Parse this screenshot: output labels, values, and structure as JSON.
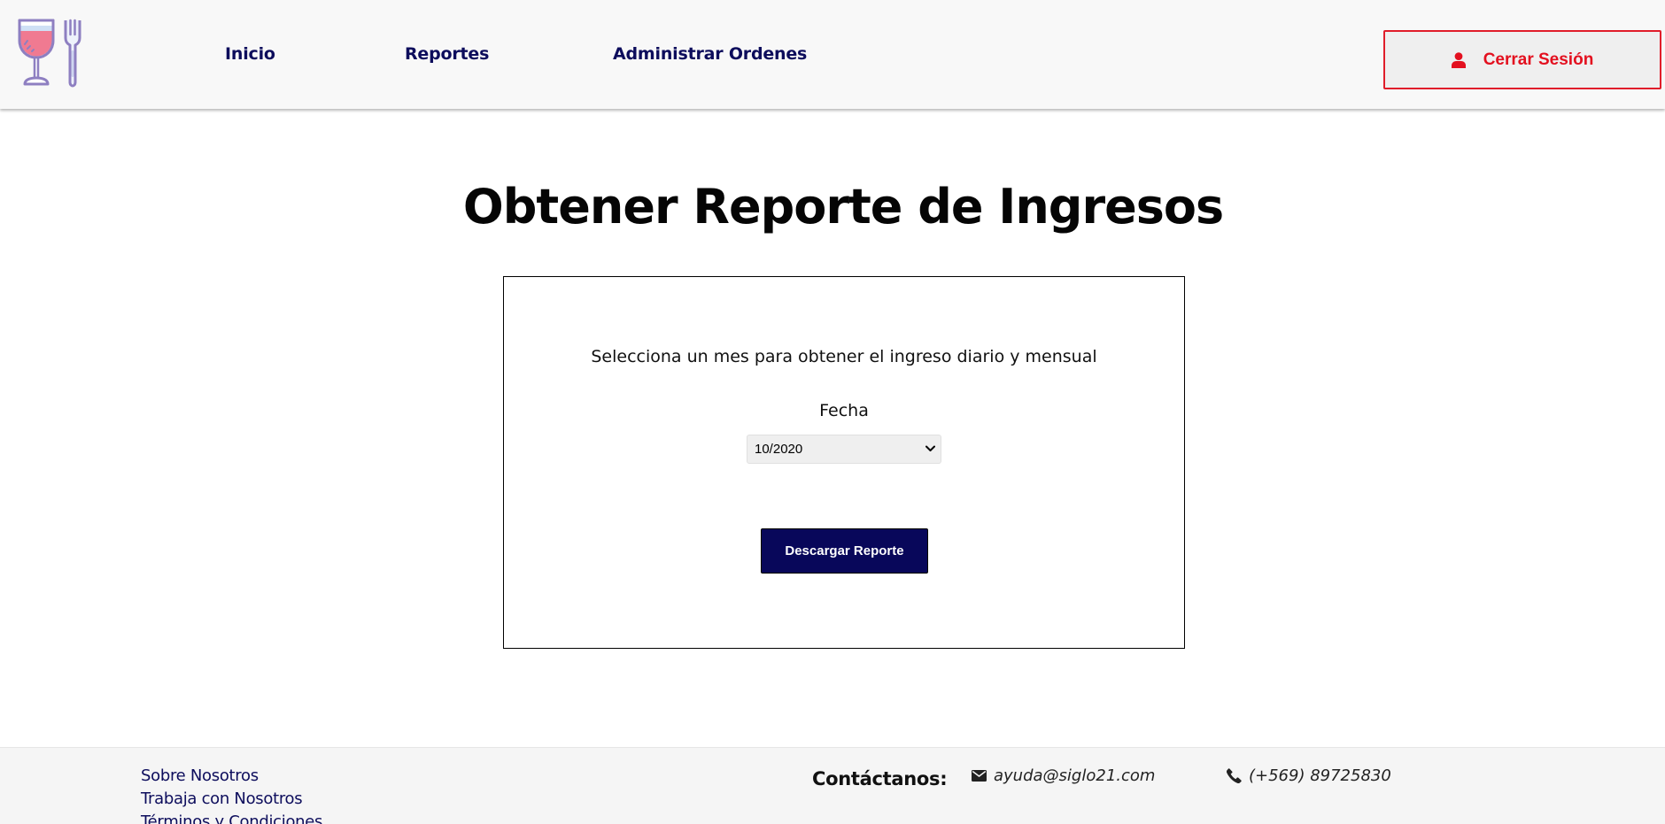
{
  "nav": {
    "items": [
      {
        "label": "Inicio"
      },
      {
        "label": "Reportes"
      },
      {
        "label": "Administrar Ordenes"
      }
    ],
    "logout_label": "Cerrar Sesión"
  },
  "main": {
    "title": "Obtener Reporte de Ingresos",
    "instruction": "Selecciona un mes para obtener el ingreso diario y mensual",
    "date_label": "Fecha",
    "date_selected": "10/2020",
    "download_label": "Descargar Reporte"
  },
  "footer": {
    "links": [
      {
        "label": "Sobre Nosotros"
      },
      {
        "label": "Trabaja con Nosotros"
      },
      {
        "label": "Términos y Condiciones"
      }
    ],
    "contact_heading": "Contáctanos:",
    "email": "ayuda@siglo21.com",
    "phone": "(+569) 89725830"
  },
  "icons": {
    "logo": "wine-glass-fork-logo",
    "logout": "user-icon",
    "select": "chevron-down-icon",
    "email": "envelope-icon",
    "phone": "phone-icon"
  },
  "colors": {
    "nav_text": "#0d0d5c",
    "logout_accent": "#e3101f",
    "button_bg": "#08075a",
    "header_bg": "#f8f8f8",
    "footer_bg": "#f5f5f5"
  }
}
